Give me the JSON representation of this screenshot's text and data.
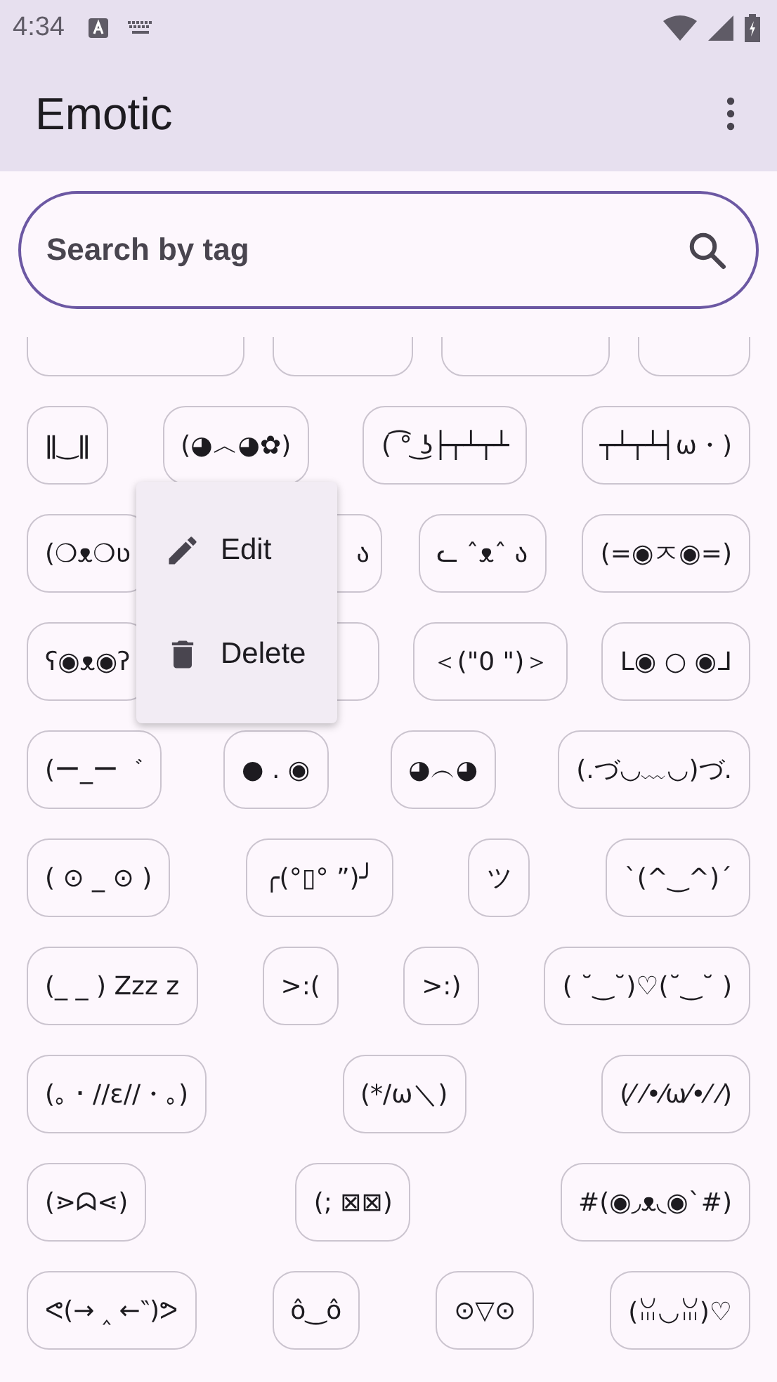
{
  "status_bar": {
    "time": "4:34"
  },
  "app_bar": {
    "title": "Emotic"
  },
  "search": {
    "placeholder": "Search by tag"
  },
  "rows": [
    {
      "items": [
        {
          "kind": "cut"
        },
        {
          "kind": "cut"
        },
        {
          "kind": "cut"
        },
        {
          "kind": "cut"
        }
      ]
    },
    {
      "items": [
        {
          "kind": "chip",
          "text": "ǁ‿ǁ"
        },
        {
          "kind": "chip",
          "text": "(◕︿◕✿)"
        },
        {
          "kind": "chip",
          "text": "( ͡° ͜ʖ├┬┴┬┴"
        },
        {
          "kind": "chip",
          "text": "┬┴┬┴┤ω・)"
        }
      ]
    },
    {
      "items": [
        {
          "kind": "chip",
          "text": "(❍ᴥ❍ʋ"
        },
        {
          "kind": "covered",
          "text": "ა"
        },
        {
          "kind": "chip",
          "text": "ᓚ ˆᴥˆ ა"
        },
        {
          "kind": "chip",
          "text": "(=◉ㅈ◉=)"
        }
      ]
    },
    {
      "items": [
        {
          "kind": "chip",
          "text": "ʕ◉ᴥ◉ʔ"
        },
        {
          "kind": "covered"
        },
        {
          "kind": "chip",
          "text": "＜(\"0 \")＞"
        },
        {
          "kind": "chip",
          "text": "ᒪ◉ ○ ◉ᒧ"
        }
      ]
    },
    {
      "items": [
        {
          "kind": "chip",
          "text": "(ー_ー゛"
        },
        {
          "kind": "chip",
          "text": "● . ◉"
        },
        {
          "kind": "chip",
          "text": "◕︵◕"
        },
        {
          "kind": "chip",
          "text": "(.づ◡﹏◡)づ."
        }
      ]
    },
    {
      "items": [
        {
          "kind": "chip",
          "text": "( ⊙ _ ⊙ )"
        },
        {
          "kind": "chip",
          "text": "╭(°▯° ”)╯"
        },
        {
          "kind": "chip",
          "text": "ツ"
        },
        {
          "kind": "chip",
          "text": "ˋ(^‿^)ˊ"
        }
      ]
    },
    {
      "items": [
        {
          "kind": "chip",
          "text": "(_ _ ) Zzz z"
        },
        {
          "kind": "chip",
          "text": ">:("
        },
        {
          "kind": "chip",
          "text": ">:)"
        },
        {
          "kind": "chip",
          "text": "( ˘‿˘)♡(˘‿˘ )"
        }
      ]
    },
    {
      "items": [
        {
          "kind": "chip",
          "text": "(｡・//ε//・｡)"
        },
        {
          "kind": "chip",
          "text": "(*/ω＼)"
        },
        {
          "kind": "chip",
          "text": "(⁄ ⁄•⁄ω⁄•⁄ ⁄)"
        }
      ]
    },
    {
      "items": [
        {
          "kind": "chip",
          "text": "(⋗ᗣ⋖)"
        },
        {
          "kind": "chip",
          "text": "(; ⊠⊠)"
        },
        {
          "kind": "chip",
          "text": "#(◉◞ᴥ◟◉`#)"
        }
      ]
    },
    {
      "items": [
        {
          "kind": "chip",
          "text": "ᕙ(→ ‸ ←‶)ᕗ"
        },
        {
          "kind": "chip",
          "text": "ô‿ô"
        },
        {
          "kind": "chip",
          "text": "⊙▽⊙"
        },
        {
          "kind": "chip",
          "text": "(ꈍ◡ꈍ)♡"
        }
      ]
    }
  ],
  "context_menu": {
    "items": [
      {
        "kind": "edit",
        "label": "Edit"
      },
      {
        "kind": "delete",
        "label": "Delete"
      }
    ]
  }
}
